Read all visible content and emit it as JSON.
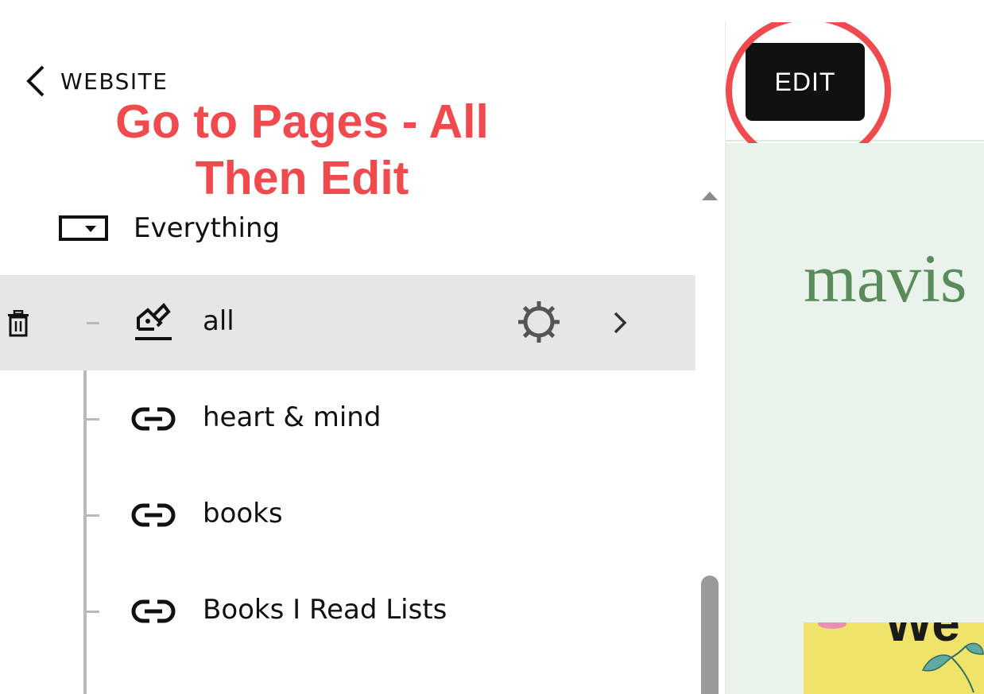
{
  "nav": {
    "back_label": "WEBSITE"
  },
  "annotation": {
    "line1": "Go to Pages - All",
    "line2": "Then Edit"
  },
  "collection": {
    "label": "Everything"
  },
  "pages": [
    {
      "label": "all",
      "icon": "blog-edit-icon",
      "selected": true
    },
    {
      "label": "heart & mind",
      "icon": "link-icon"
    },
    {
      "label": "books",
      "icon": "link-icon"
    },
    {
      "label": "Books I Read Lists",
      "icon": "link-icon"
    }
  ],
  "preview": {
    "edit_label": "EDIT",
    "site_title": "mavis",
    "book_text": "We"
  },
  "colors": {
    "annotation": "#ef4b4f",
    "selected_row": "#e6e6e6",
    "site_background": "#e9f3ec",
    "site_title": "#5a8b5c",
    "edit_button": "#111111"
  }
}
